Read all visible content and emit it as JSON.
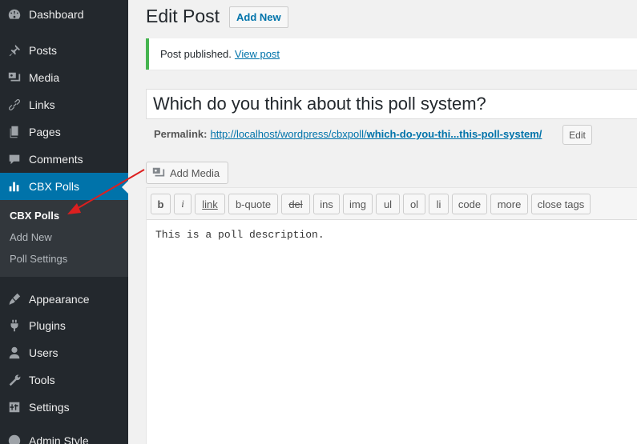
{
  "sidebar": {
    "items": [
      {
        "label": "Dashboard",
        "icon": "dashboard-icon"
      },
      {
        "label": "Posts",
        "icon": "pin-icon"
      },
      {
        "label": "Media",
        "icon": "media-icon"
      },
      {
        "label": "Links",
        "icon": "link-icon"
      },
      {
        "label": "Pages",
        "icon": "page-icon"
      },
      {
        "label": "Comments",
        "icon": "comment-icon"
      },
      {
        "label": "CBX Polls",
        "icon": "bar-chart-icon"
      },
      {
        "label": "Appearance",
        "icon": "brush-icon"
      },
      {
        "label": "Plugins",
        "icon": "plug-icon"
      },
      {
        "label": "Users",
        "icon": "user-icon"
      },
      {
        "label": "Tools",
        "icon": "wrench-icon"
      },
      {
        "label": "Settings",
        "icon": "settings-icon"
      },
      {
        "label": "Admin Style",
        "icon": "palette-icon"
      }
    ],
    "submenu": [
      "CBX Polls",
      "Add New",
      "Poll Settings"
    ]
  },
  "main": {
    "title": "Edit Post",
    "add_new": "Add New",
    "notice_text": "Post published.",
    "notice_link": "View post",
    "post_title": "Which do you think about this poll system?",
    "permalink_label": "Permalink:",
    "permalink_base": "http://localhost/wordpress/cbxpoll/",
    "permalink_slug": "which-do-you-thi...this-poll-system/",
    "edit_btn": "Edit",
    "add_media": "Add Media",
    "toolbar": [
      "b",
      "i",
      "link",
      "b-quote",
      "del",
      "ins",
      "img",
      "ul",
      "ol",
      "li",
      "code",
      "more",
      "close tags"
    ],
    "content": "This is a poll description."
  },
  "colors": {
    "sidebar_bg": "#23282d",
    "accent": "#0073aa",
    "notice_green": "#46b450",
    "arrow": "#dd1f1f"
  }
}
